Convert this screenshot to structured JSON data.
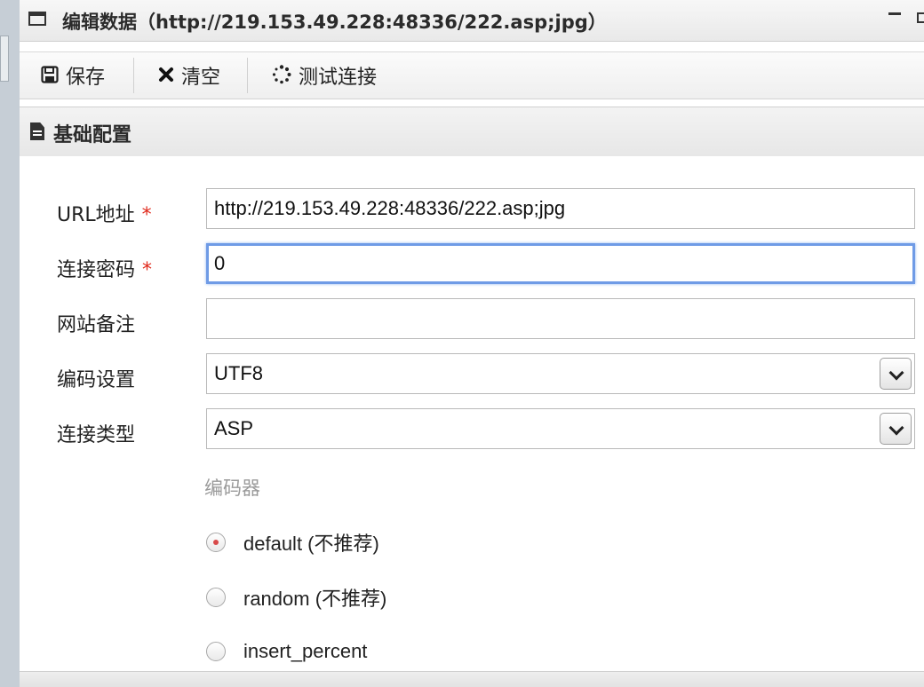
{
  "window": {
    "title": "编辑数据（http://219.153.49.228:48336/222.asp;jpg）"
  },
  "toolbar": {
    "save_label": "保存",
    "clear_label": "清空",
    "test_label": "测试连接"
  },
  "section": {
    "title": "基础配置"
  },
  "form": {
    "url_label": "URL地址",
    "url_value": "http://219.153.49.228:48336/222.asp;jpg",
    "password_label": "连接密码",
    "password_value": "0",
    "note_label": "网站备注",
    "note_value": "",
    "encoding_label": "编码设置",
    "encoding_value": "UTF8",
    "type_label": "连接类型",
    "type_value": "ASP",
    "required_mark": "*",
    "encoder_label": "编码器",
    "encoders": [
      {
        "label": "default (不推荐)",
        "checked": true
      },
      {
        "label": "random (不推荐)",
        "checked": false
      },
      {
        "label": "insert_percent",
        "checked": false
      }
    ]
  },
  "colors": {
    "required": "#e0291b",
    "focus_border": "#6f9be6",
    "radio_checked": "#d84a4a"
  }
}
